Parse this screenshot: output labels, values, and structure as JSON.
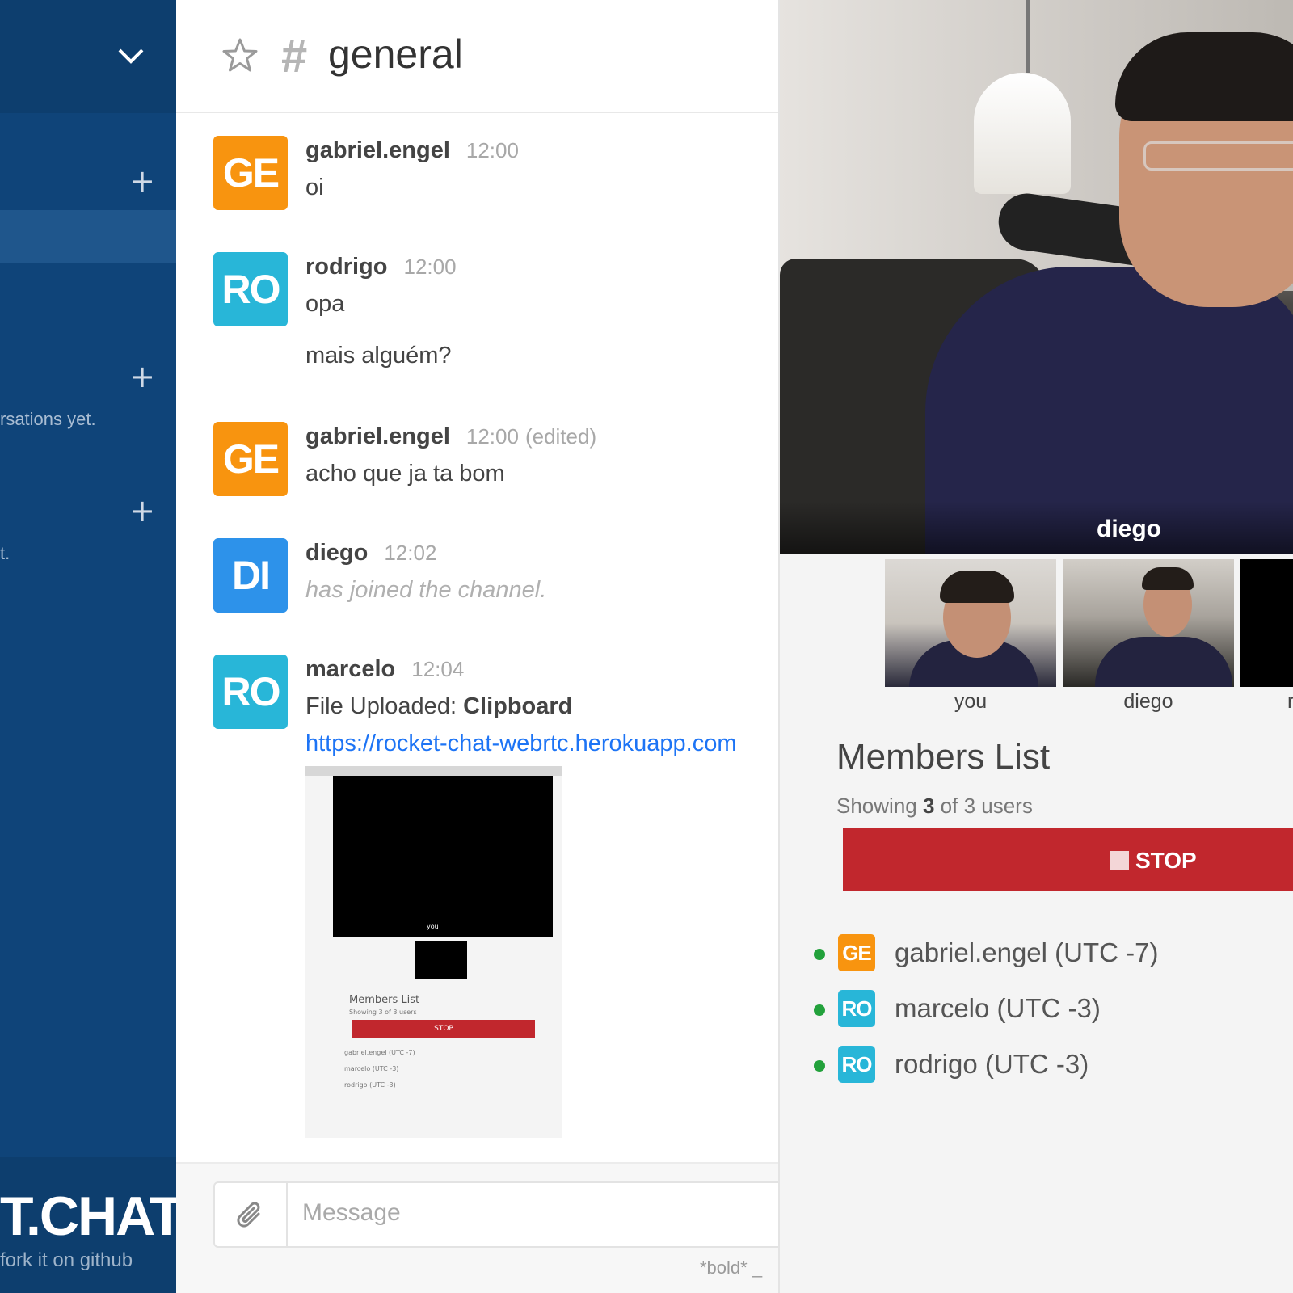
{
  "sidebar": {
    "empty_text_1": "rsations yet.",
    "empty_text_2": "t.",
    "logo": "T.CHAT",
    "fork_link": "fork it on github",
    "plus": "+"
  },
  "header": {
    "hash": "#",
    "channel": "general"
  },
  "messages": [
    {
      "avatar": "GE",
      "user": "gabriel.engel",
      "time": "12:00",
      "lines": [
        "oi"
      ]
    },
    {
      "avatar": "RO",
      "user": "rodrigo",
      "time": "12:00",
      "lines": [
        "opa",
        "mais alguém?"
      ]
    },
    {
      "avatar": "GE",
      "user": "gabriel.engel",
      "time": "12:00",
      "edited": "(edited)",
      "lines": [
        "acho que ja ta bom"
      ]
    },
    {
      "avatar": "DI",
      "user": "diego",
      "time": "12:02",
      "lines": [
        "has joined the channel."
      ]
    },
    {
      "avatar": "RO",
      "user": "marcelo",
      "time": "12:04",
      "upload_prefix": "File Uploaded:",
      "upload_name": "Clipboard",
      "link": "https://rocket-chat-webrtc.herokuapp.com"
    }
  ],
  "upload_preview": {
    "you": "you",
    "members_list": "Members List",
    "showing": "Showing 3 of 3 users",
    "stop": "STOP",
    "members": [
      "gabriel.engel (UTC -7)",
      "marcelo (UTC -3)",
      "rodrigo (UTC -3)"
    ]
  },
  "composer": {
    "placeholder": "Message",
    "hint": "*bold*  _"
  },
  "video": {
    "main_name": "diego",
    "thumbs": [
      "you",
      "diego",
      "r"
    ]
  },
  "members_panel": {
    "title": "Members List",
    "showing_prefix": "Showing",
    "showing_count": "3",
    "showing_suffix": "of 3 users",
    "stop_label": "STOP",
    "members": [
      {
        "avatar": "GE",
        "name": "gabriel.engel (UTC -7)",
        "color": "#f8940f"
      },
      {
        "avatar": "RO",
        "name": "marcelo (UTC -3)",
        "color": "#28b6d8"
      },
      {
        "avatar": "RO",
        "name": "rodrigo (UTC -3)",
        "color": "#28b6d8"
      }
    ]
  },
  "colors": {
    "sidebar": "#0f4479",
    "stop": "#c1272d",
    "online": "#22a13b",
    "link": "#1d74f5"
  }
}
